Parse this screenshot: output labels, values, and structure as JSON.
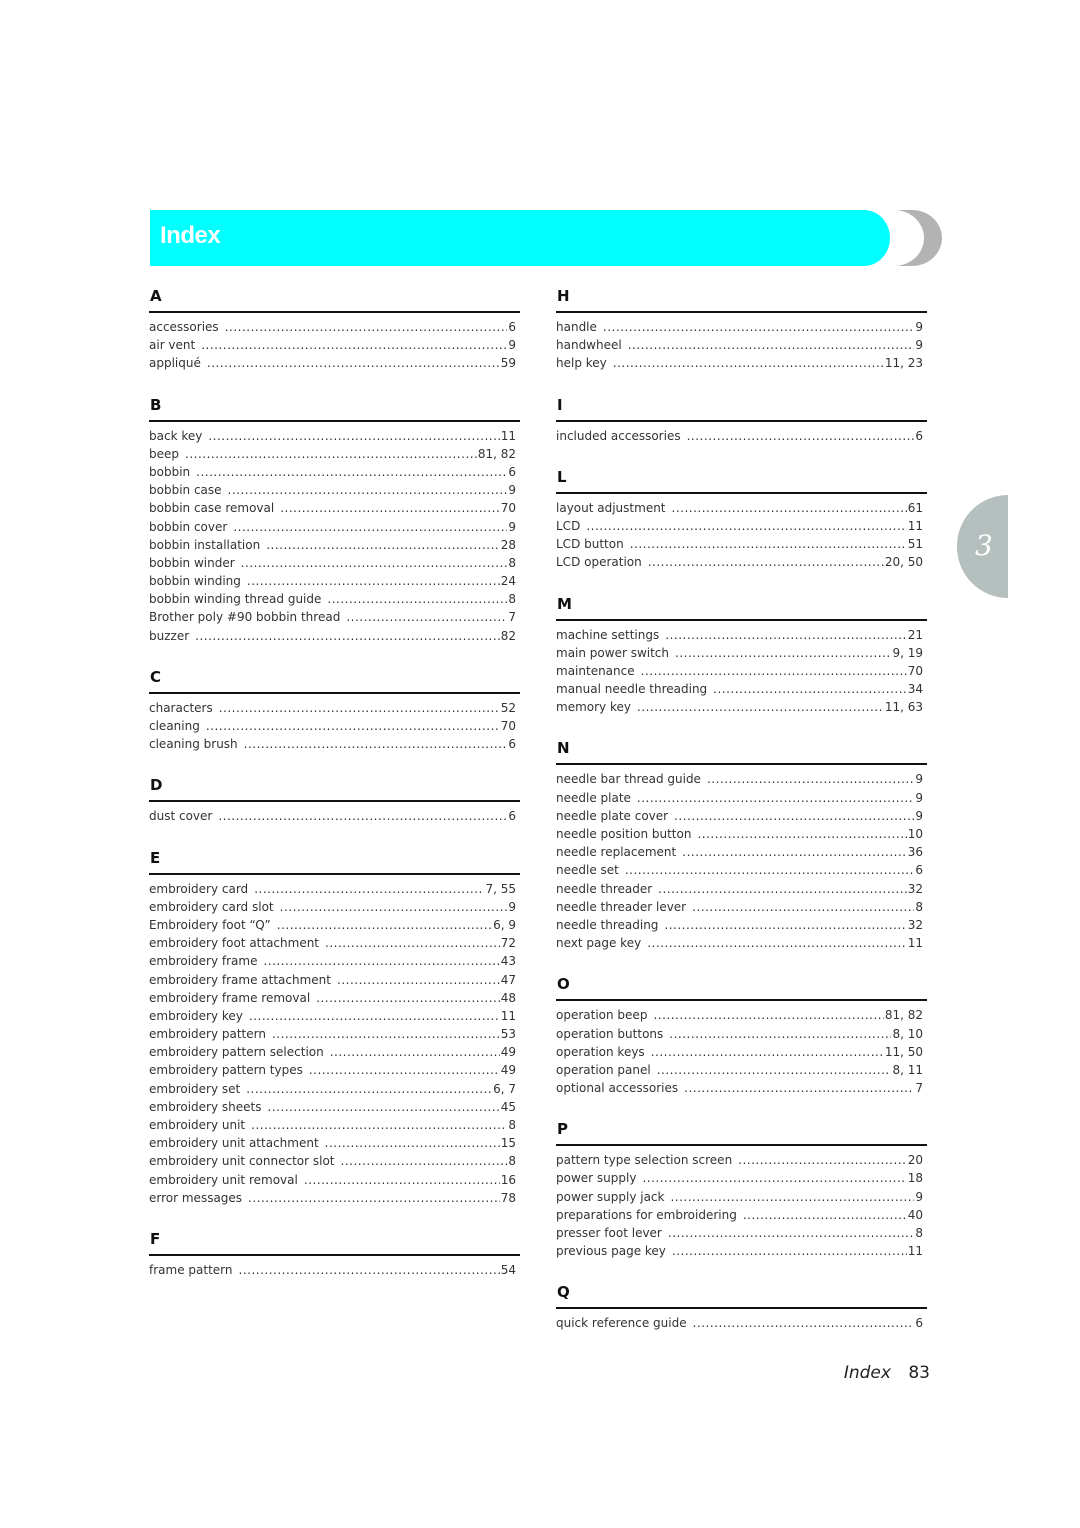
{
  "header": {
    "title": "Index"
  },
  "chapter_tab": {
    "number": "3"
  },
  "footer": {
    "label": "Index",
    "page_number": "83"
  },
  "left_column": [
    {
      "letter": "A",
      "entries": [
        {
          "term": "accessories",
          "pages": "6"
        },
        {
          "term": "air vent",
          "pages": "9"
        },
        {
          "term": "appliqué",
          "pages": "59"
        }
      ]
    },
    {
      "letter": "B",
      "entries": [
        {
          "term": "back key",
          "pages": "11"
        },
        {
          "term": "beep",
          "pages": "81, 82"
        },
        {
          "term": "bobbin",
          "pages": "6"
        },
        {
          "term": "bobbin case",
          "pages": "9"
        },
        {
          "term": "bobbin case removal",
          "pages": "70"
        },
        {
          "term": "bobbin cover",
          "pages": "9"
        },
        {
          "term": "bobbin installation",
          "pages": "28"
        },
        {
          "term": "bobbin winder",
          "pages": "8"
        },
        {
          "term": "bobbin winding",
          "pages": "24"
        },
        {
          "term": "bobbin winding thread guide",
          "pages": "8"
        },
        {
          "term": "Brother poly #90 bobbin thread",
          "pages": "7"
        },
        {
          "term": "buzzer",
          "pages": "82"
        }
      ]
    },
    {
      "letter": "C",
      "entries": [
        {
          "term": "characters",
          "pages": "52"
        },
        {
          "term": "cleaning",
          "pages": "70"
        },
        {
          "term": "cleaning brush",
          "pages": "6"
        }
      ]
    },
    {
      "letter": "D",
      "entries": [
        {
          "term": "dust cover",
          "pages": "6"
        }
      ]
    },
    {
      "letter": "E",
      "entries": [
        {
          "term": "embroidery card",
          "pages": "7, 55"
        },
        {
          "term": "embroidery card slot",
          "pages": "9"
        },
        {
          "term": "Embroidery foot “Q”",
          "pages": "6, 9"
        },
        {
          "term": "embroidery foot attachment",
          "pages": "72"
        },
        {
          "term": "embroidery frame",
          "pages": "43"
        },
        {
          "term": "embroidery frame attachment",
          "pages": "47"
        },
        {
          "term": "embroidery frame removal",
          "pages": "48"
        },
        {
          "term": "embroidery key",
          "pages": "11"
        },
        {
          "term": "embroidery pattern",
          "pages": "53"
        },
        {
          "term": "embroidery pattern selection",
          "pages": "49"
        },
        {
          "term": "embroidery pattern types",
          "pages": "49"
        },
        {
          "term": "embroidery set",
          "pages": "6, 7"
        },
        {
          "term": "embroidery sheets",
          "pages": "45"
        },
        {
          "term": "embroidery unit",
          "pages": "8"
        },
        {
          "term": "embroidery unit attachment",
          "pages": "15"
        },
        {
          "term": "embroidery unit connector slot",
          "pages": "8"
        },
        {
          "term": "embroidery unit removal",
          "pages": "16"
        },
        {
          "term": "error messages",
          "pages": "78"
        }
      ]
    },
    {
      "letter": "F",
      "entries": [
        {
          "term": "frame pattern",
          "pages": "54"
        }
      ]
    }
  ],
  "right_column": [
    {
      "letter": "H",
      "entries": [
        {
          "term": "handle",
          "pages": "9"
        },
        {
          "term": "handwheel",
          "pages": "9"
        },
        {
          "term": "help key",
          "pages": "11, 23"
        }
      ]
    },
    {
      "letter": "I",
      "entries": [
        {
          "term": "included accessories",
          "pages": "6"
        }
      ]
    },
    {
      "letter": "L",
      "entries": [
        {
          "term": "layout adjustment",
          "pages": "61"
        },
        {
          "term": "LCD",
          "pages": "11"
        },
        {
          "term": "LCD button",
          "pages": "51"
        },
        {
          "term": "LCD operation",
          "pages": "20, 50"
        }
      ]
    },
    {
      "letter": "M",
      "entries": [
        {
          "term": "machine settings",
          "pages": "21"
        },
        {
          "term": "main power switch",
          "pages": "9, 19"
        },
        {
          "term": "maintenance",
          "pages": "70"
        },
        {
          "term": "manual needle threading",
          "pages": "34"
        },
        {
          "term": "memory key",
          "pages": "11, 63"
        }
      ]
    },
    {
      "letter": "N",
      "entries": [
        {
          "term": "needle bar thread guide",
          "pages": "9"
        },
        {
          "term": "needle plate",
          "pages": "9"
        },
        {
          "term": "needle plate cover",
          "pages": "9"
        },
        {
          "term": "needle position button",
          "pages": "10"
        },
        {
          "term": "needle replacement",
          "pages": "36"
        },
        {
          "term": "needle set",
          "pages": "6"
        },
        {
          "term": "needle threader",
          "pages": "32"
        },
        {
          "term": "needle threader lever",
          "pages": "8"
        },
        {
          "term": "needle threading",
          "pages": "32"
        },
        {
          "term": "next page key",
          "pages": "11"
        }
      ]
    },
    {
      "letter": "O",
      "entries": [
        {
          "term": "operation beep",
          "pages": "81, 82"
        },
        {
          "term": "operation buttons",
          "pages": "8, 10"
        },
        {
          "term": "operation keys",
          "pages": "11, 50"
        },
        {
          "term": "operation panel",
          "pages": "8, 11"
        },
        {
          "term": "optional accessories",
          "pages": "7"
        }
      ]
    },
    {
      "letter": "P",
      "entries": [
        {
          "term": "pattern type selection screen",
          "pages": "20"
        },
        {
          "term": "power supply",
          "pages": "18"
        },
        {
          "term": "power supply jack",
          "pages": "9"
        },
        {
          "term": "preparations for embroidering",
          "pages": "40"
        },
        {
          "term": "presser foot lever",
          "pages": "8"
        },
        {
          "term": "previous page key",
          "pages": "11"
        }
      ]
    },
    {
      "letter": "Q",
      "entries": [
        {
          "term": "quick reference guide",
          "pages": "6"
        }
      ]
    }
  ]
}
